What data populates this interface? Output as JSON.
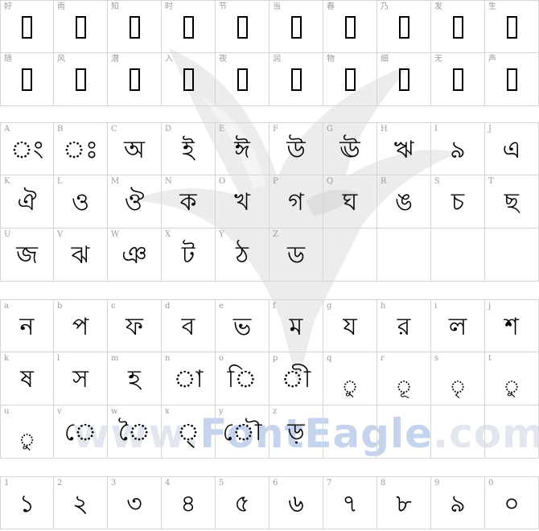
{
  "watermark": {
    "prefix": "www.",
    "brand": "FontEagle",
    "suffix": ".com"
  },
  "sections": [
    {
      "rows": [
        [
          {
            "key": "好",
            "glyph": "",
            "kind": "notdef"
          },
          {
            "key": "雨",
            "glyph": "",
            "kind": "notdef"
          },
          {
            "key": "知",
            "glyph": "",
            "kind": "notdef"
          },
          {
            "key": "时",
            "glyph": "",
            "kind": "notdef"
          },
          {
            "key": "节",
            "glyph": "",
            "kind": "notdef"
          },
          {
            "key": "当",
            "glyph": "",
            "kind": "notdef"
          },
          {
            "key": "春",
            "glyph": "",
            "kind": "notdef"
          },
          {
            "key": "乃",
            "glyph": "",
            "kind": "notdef"
          },
          {
            "key": "发",
            "glyph": "",
            "kind": "notdef"
          },
          {
            "key": "生",
            "glyph": "",
            "kind": "notdef"
          }
        ],
        [
          {
            "key": "随",
            "glyph": "",
            "kind": "notdef"
          },
          {
            "key": "风",
            "glyph": "",
            "kind": "notdef"
          },
          {
            "key": "潜",
            "glyph": "",
            "kind": "notdef"
          },
          {
            "key": "入",
            "glyph": "",
            "kind": "notdef"
          },
          {
            "key": "夜",
            "glyph": "",
            "kind": "notdef"
          },
          {
            "key": "润",
            "glyph": "",
            "kind": "notdef"
          },
          {
            "key": "物",
            "glyph": "",
            "kind": "notdef"
          },
          {
            "key": "细",
            "glyph": "",
            "kind": "notdef"
          },
          {
            "key": "无",
            "glyph": "",
            "kind": "notdef"
          },
          {
            "key": "声",
            "glyph": "",
            "kind": "notdef"
          }
        ]
      ]
    },
    {
      "rows": [
        [
          {
            "key": "A",
            "glyph": "ং"
          },
          {
            "key": "B",
            "glyph": "ঃ"
          },
          {
            "key": "C",
            "glyph": "অ"
          },
          {
            "key": "D",
            "glyph": "ই"
          },
          {
            "key": "E",
            "glyph": "ঈ"
          },
          {
            "key": "F",
            "glyph": "উ"
          },
          {
            "key": "G",
            "glyph": "ঊ"
          },
          {
            "key": "H",
            "glyph": "ঋ"
          },
          {
            "key": "I",
            "glyph": "৯"
          },
          {
            "key": "J",
            "glyph": "এ"
          }
        ],
        [
          {
            "key": "K",
            "glyph": "ঐ"
          },
          {
            "key": "L",
            "glyph": "ও"
          },
          {
            "key": "M",
            "glyph": "ঔ"
          },
          {
            "key": "N",
            "glyph": "ক"
          },
          {
            "key": "O",
            "glyph": "খ"
          },
          {
            "key": "P",
            "glyph": "গ"
          },
          {
            "key": "Q",
            "glyph": "ঘ"
          },
          {
            "key": "R",
            "glyph": "ঙ"
          },
          {
            "key": "S",
            "glyph": "চ"
          },
          {
            "key": "T",
            "glyph": "ছ"
          }
        ],
        [
          {
            "key": "U",
            "glyph": "জ"
          },
          {
            "key": "V",
            "glyph": "ঝ"
          },
          {
            "key": "W",
            "glyph": "ঞ"
          },
          {
            "key": "X",
            "glyph": "ট"
          },
          {
            "key": "Y",
            "glyph": "ঠ"
          },
          {
            "key": "Z",
            "glyph": "ড"
          },
          {
            "key": "",
            "glyph": ""
          },
          {
            "key": "",
            "glyph": ""
          },
          {
            "key": "",
            "glyph": ""
          },
          {
            "key": "",
            "glyph": ""
          }
        ]
      ]
    },
    {
      "rows": [
        [
          {
            "key": "a",
            "glyph": "ন"
          },
          {
            "key": "b",
            "glyph": "প"
          },
          {
            "key": "c",
            "glyph": "ফ"
          },
          {
            "key": "d",
            "glyph": "ব"
          },
          {
            "key": "e",
            "glyph": "ভ"
          },
          {
            "key": "f",
            "glyph": "ম"
          },
          {
            "key": "g",
            "glyph": "য"
          },
          {
            "key": "h",
            "glyph": "র"
          },
          {
            "key": "i",
            "glyph": "ল"
          },
          {
            "key": "j",
            "glyph": "শ"
          }
        ],
        [
          {
            "key": "k",
            "glyph": "ষ"
          },
          {
            "key": "l",
            "glyph": "স"
          },
          {
            "key": "m",
            "glyph": "হ"
          },
          {
            "key": "n",
            "glyph": "া"
          },
          {
            "key": "o",
            "glyph": "ি"
          },
          {
            "key": "p",
            "glyph": "ী"
          },
          {
            "key": "q",
            "glyph": "ু",
            "kind": "low"
          },
          {
            "key": "r",
            "glyph": "ূ",
            "kind": "low"
          },
          {
            "key": "s",
            "glyph": "ৃ",
            "kind": "low"
          },
          {
            "key": "t",
            "glyph": "ু",
            "kind": "low"
          }
        ],
        [
          {
            "key": "u",
            "glyph": "ু",
            "kind": "low"
          },
          {
            "key": "v",
            "glyph": "ে"
          },
          {
            "key": "w",
            "glyph": "ৈ"
          },
          {
            "key": "x",
            "glyph": "্"
          },
          {
            "key": "y",
            "glyph": "ৌ"
          },
          {
            "key": "z",
            "glyph": "ড়"
          },
          {
            "key": "",
            "glyph": ""
          },
          {
            "key": "",
            "glyph": ""
          },
          {
            "key": "",
            "glyph": ""
          },
          {
            "key": "",
            "glyph": ""
          }
        ]
      ]
    },
    {
      "rows": [
        [
          {
            "key": "1",
            "glyph": "১"
          },
          {
            "key": "2",
            "glyph": "২"
          },
          {
            "key": "3",
            "glyph": "৩"
          },
          {
            "key": "4",
            "glyph": "৪"
          },
          {
            "key": "5",
            "glyph": "৫"
          },
          {
            "key": "6",
            "glyph": "৬"
          },
          {
            "key": "7",
            "glyph": "৭"
          },
          {
            "key": "8",
            "glyph": "৮"
          },
          {
            "key": "9",
            "glyph": "৯"
          },
          {
            "key": "0",
            "glyph": "০"
          }
        ]
      ]
    }
  ]
}
